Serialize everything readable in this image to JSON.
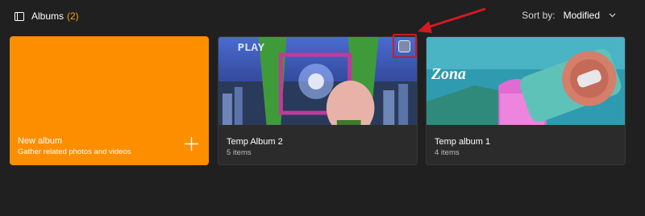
{
  "header": {
    "title": "Albums",
    "count": "(2)",
    "count_color": "#f7a00f",
    "icon": "albums-icon"
  },
  "sort": {
    "label": "Sort by:",
    "value": "Modified",
    "icon": "chevron-down-icon"
  },
  "new_album": {
    "title": "New album",
    "subtitle": "Gather related photos and videos",
    "icon": "plus-icon",
    "color": "#fc8e00"
  },
  "albums": [
    {
      "title": "Temp Album 2",
      "count": "5 items",
      "thumb_text": "PLAY"
    },
    {
      "title": "Temp album 1",
      "count": "4 items",
      "thumb_text": "Zona"
    }
  ],
  "annotation": {
    "highlight_color": "#d31a23"
  }
}
